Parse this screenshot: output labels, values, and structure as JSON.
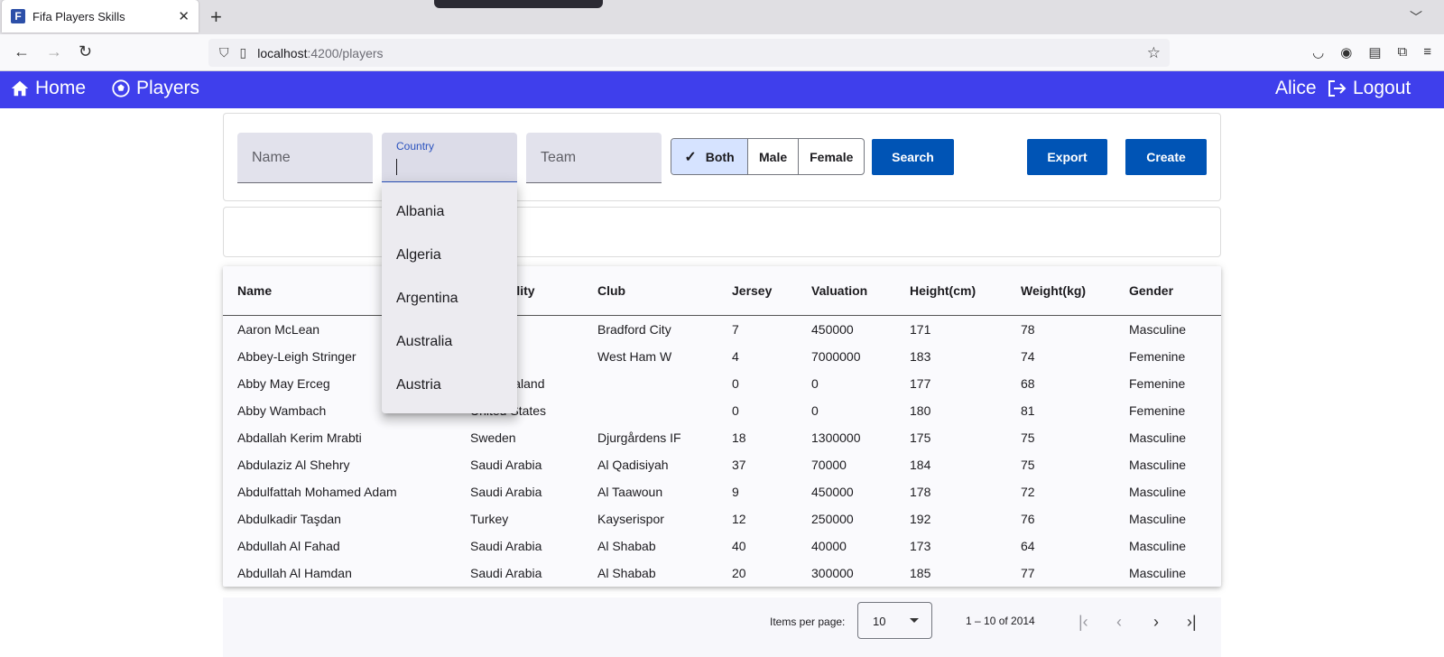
{
  "browser": {
    "tab_title": "Fifa Players Skills",
    "favicon_letter": "F",
    "url_host": "localhost",
    "url_path": ":4200/players"
  },
  "header": {
    "home_label": "Home",
    "players_label": "Players",
    "user_name": "Alice",
    "logout_label": "Logout",
    "bg_color": "#3f3fec"
  },
  "filters": {
    "name_placeholder": "Name",
    "country_label": "Country",
    "team_placeholder": "Team",
    "gender_options": [
      "Both",
      "Male",
      "Female"
    ],
    "gender_selected": "Both",
    "search_label": "Search",
    "export_label": "Export",
    "create_label": "Create"
  },
  "country_dropdown": [
    "Albania",
    "Algeria",
    "Argentina",
    "Australia",
    "Austria"
  ],
  "table": {
    "headers": [
      "Name",
      "Nationality",
      "Club",
      "Jersey",
      "Valuation",
      "Height(cm)",
      "Weight(kg)",
      "Gender"
    ],
    "rows": [
      [
        "Aaron McLean",
        "",
        "Bradford City",
        "7",
        "450000",
        "171",
        "78",
        "Masculine"
      ],
      [
        "Abbey-Leigh Stringer",
        "",
        "West Ham W",
        "4",
        "7000000",
        "183",
        "74",
        "Femenine"
      ],
      [
        "Abby May Erceg",
        "New Zealand",
        "",
        "0",
        "0",
        "177",
        "68",
        "Femenine"
      ],
      [
        "Abby Wambach",
        "United States",
        "",
        "0",
        "0",
        "180",
        "81",
        "Femenine"
      ],
      [
        "Abdallah Kerim Mrabti",
        "Sweden",
        "Djurgårdens IF",
        "18",
        "1300000",
        "175",
        "75",
        "Masculine"
      ],
      [
        "Abdulaziz Al Shehry",
        "Saudi Arabia",
        "Al Qadisiyah",
        "37",
        "70000",
        "184",
        "75",
        "Masculine"
      ],
      [
        "Abdulfattah Mohamed Adam",
        "Saudi Arabia",
        "Al Taawoun",
        "9",
        "450000",
        "178",
        "72",
        "Masculine"
      ],
      [
        "Abdulkadir Taşdan",
        "Turkey",
        "Kayserispor",
        "12",
        "250000",
        "192",
        "76",
        "Masculine"
      ],
      [
        "Abdullah Al Fahad",
        "Saudi Arabia",
        "Al Shabab",
        "40",
        "40000",
        "173",
        "64",
        "Masculine"
      ],
      [
        "Abdullah Al Hamdan",
        "Saudi Arabia",
        "Al Shabab",
        "20",
        "300000",
        "185",
        "77",
        "Masculine"
      ]
    ]
  },
  "paginator": {
    "items_per_page_label": "Items per page:",
    "page_size": "10",
    "range_label": "1 – 10 of 2014"
  }
}
